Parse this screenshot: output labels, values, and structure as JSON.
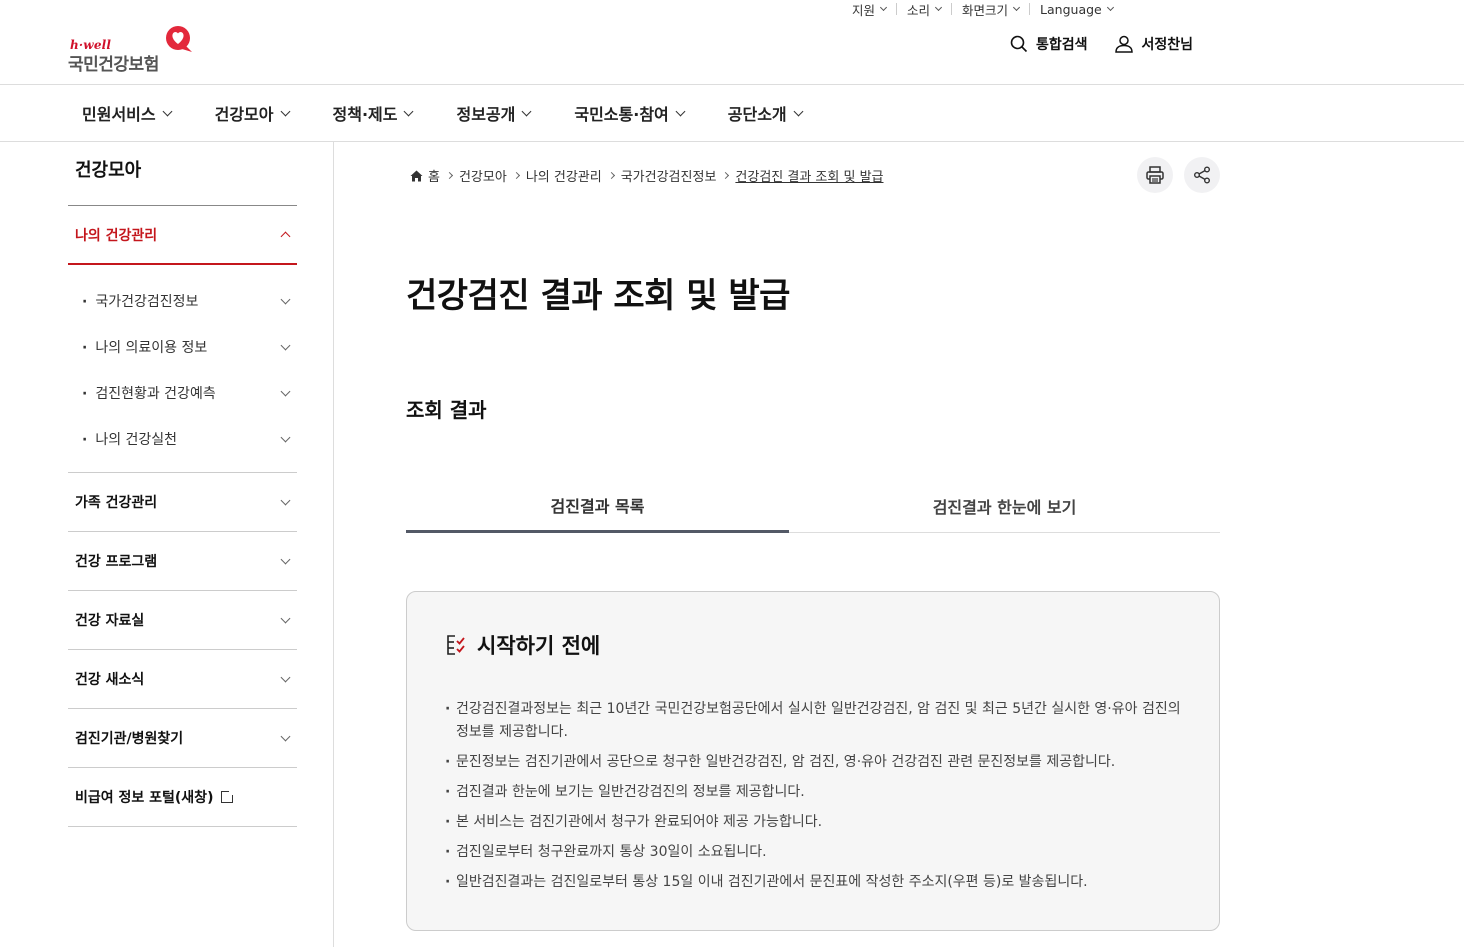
{
  "utility": [
    {
      "label": "지원"
    },
    {
      "label": "소리"
    },
    {
      "label": "화면크기"
    },
    {
      "label": "Language"
    }
  ],
  "logo": {
    "tagline": "h·well",
    "name": "국민건강보험"
  },
  "header": {
    "search_label": "통합검색",
    "user_label": "서정찬님"
  },
  "gnb": [
    "민원서비스",
    "건강모아",
    "정책·제도",
    "정보공개",
    "국민소통·참여",
    "공단소개"
  ],
  "sidebar": {
    "title": "건강모아",
    "open_item": "나의 건강관리",
    "sub_items": [
      "국가건강검진정보",
      "나의 의료이용 정보",
      "검진현황과 건강예측",
      "나의 건강실천"
    ],
    "items": [
      "가족 건강관리",
      "건강 프로그램",
      "건강 자료실",
      "건강 새소식",
      "검진기관/병원찾기"
    ],
    "external_item": "비급여 정보 포털(새창)"
  },
  "breadcrumb": [
    "홈",
    "건강모아",
    "나의 건강관리",
    "국가건강검진정보",
    "건강검진 결과 조회 및 발급"
  ],
  "page_title": "건강검진 결과 조회 및 발급",
  "section_title": "조회 결과",
  "tabs": [
    "검진결과 목록",
    "검진결과 한눈에 보기"
  ],
  "notice": {
    "title": "시작하기 전에",
    "items": [
      "건강검진결과정보는 최근 10년간 국민건강보험공단에서 실시한 일반건강검진, 암 검진 및 최근 5년간 실시한 영·유아 검진의 정보를 제공합니다.",
      "문진정보는 검진기관에서 공단으로 청구한 일반건강검진, 암 검진, 영·유아 건강검진 관련 문진정보를 제공합니다.",
      "검진결과 한눈에 보기는 일반건강검진의 정보를 제공합니다.",
      "본 서비스는 검진기관에서 청구가 완료되어야 제공 가능합니다.",
      "검진일로부터 청구완료까지 통상 30일이 소요됩니다.",
      "일반검진결과는 검진일로부터 통상 15일 이내 검진기관에서 문진표에 작성한 주소지(우편 등)로 발송됩니다."
    ]
  },
  "colors": {
    "accent": "#c4161c",
    "tab_active": "#535966",
    "box_bg": "#f6f6f6"
  }
}
